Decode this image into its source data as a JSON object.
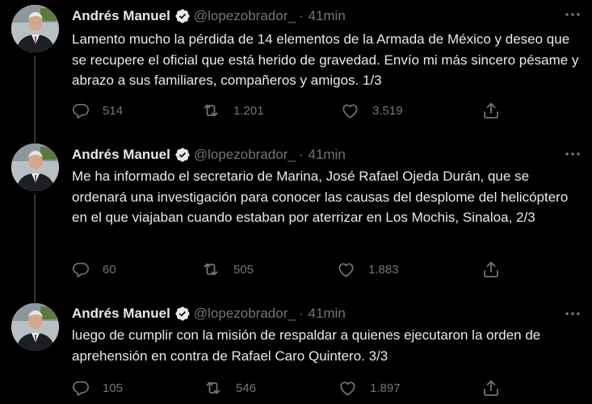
{
  "tweets": [
    {
      "author_name": "Andrés Manuel",
      "handle": "@lopezobrador_",
      "separator": "·",
      "time": "41min",
      "text": "Lamento mucho la pérdida de 14 elementos de la Armada de México y deseo que se recupere el oficial que está herido de gravedad. Envío mi más sincero pésame y abrazo a sus familiares, compañeros y amigos. 1/3",
      "replies": "514",
      "retweets": "1.201",
      "likes": "3.519"
    },
    {
      "author_name": "Andrés Manuel",
      "handle": "@lopezobrador_",
      "separator": "·",
      "time": "41min",
      "text": "Me ha informado el secretario de Marina, José Rafael Ojeda Durán, que se ordenará una investigación para conocer las causas del desplome del helicóptero en el que viajaban cuando estaban por aterrizar en Los Mochis, Sinaloa, 2/3",
      "replies": "60",
      "retweets": "505",
      "likes": "1.883"
    },
    {
      "author_name": "Andrés Manuel",
      "handle": "@lopezobrador_",
      "separator": "·",
      "time": "41min",
      "text": "luego de cumplir con la misión de respaldar a quienes ejecutaron la orden de aprehensión en contra de Rafael Caro Quintero. 3/3",
      "replies": "105",
      "retweets": "546",
      "likes": "1.897"
    }
  ],
  "icons": {
    "verified": "verified-badge-icon",
    "more": "more-options-icon",
    "reply": "reply-icon",
    "retweet": "retweet-icon",
    "like": "like-icon",
    "share": "share-icon"
  },
  "colors": {
    "background": "#000000",
    "primary_text": "#e7e9ea",
    "secondary_text": "#71767b",
    "thread_line": "#333639"
  }
}
